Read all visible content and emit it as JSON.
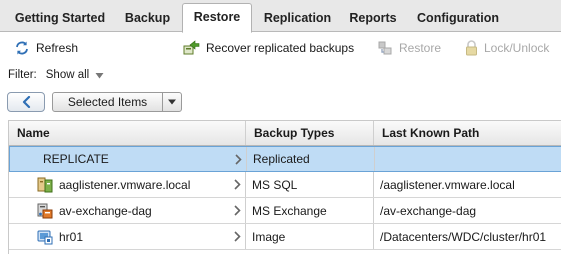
{
  "tabs": [
    {
      "label": "Getting Started",
      "active": false
    },
    {
      "label": "Backup",
      "active": false
    },
    {
      "label": "Restore",
      "active": true
    },
    {
      "label": "Replication",
      "active": false
    },
    {
      "label": "Reports",
      "active": false
    },
    {
      "label": "Configuration",
      "active": false
    }
  ],
  "toolbar": {
    "refresh": "Refresh",
    "recover": "Recover replicated backups",
    "restore": "Restore",
    "lock": "Lock/Unlock"
  },
  "filter": {
    "label": "Filter:",
    "value": "Show all"
  },
  "nav": {
    "selected_items": "Selected Items"
  },
  "table": {
    "columns": [
      "Name",
      "Backup Types",
      "Last Known Path"
    ],
    "rows": [
      {
        "name": "REPLICATE",
        "type": "Replicated",
        "path": "",
        "icon": "none",
        "selected": true
      },
      {
        "name": "aaglistener.vmware.local",
        "type": "MS SQL",
        "path": "/aaglistener.vmware.local",
        "icon": "sql-server-icon",
        "selected": false
      },
      {
        "name": "av-exchange-dag",
        "type": "MS Exchange",
        "path": "/av-exchange-dag",
        "icon": "exchange-server-icon",
        "selected": false
      },
      {
        "name": "hr01",
        "type": "Image",
        "path": "/Datacenters/WDC/cluster/hr01",
        "icon": "vm-image-icon",
        "selected": false
      }
    ]
  },
  "colors": {
    "selection": "#bfdcf5",
    "selection_border": "#6aa3d6",
    "accent": "#2f6fb5"
  }
}
